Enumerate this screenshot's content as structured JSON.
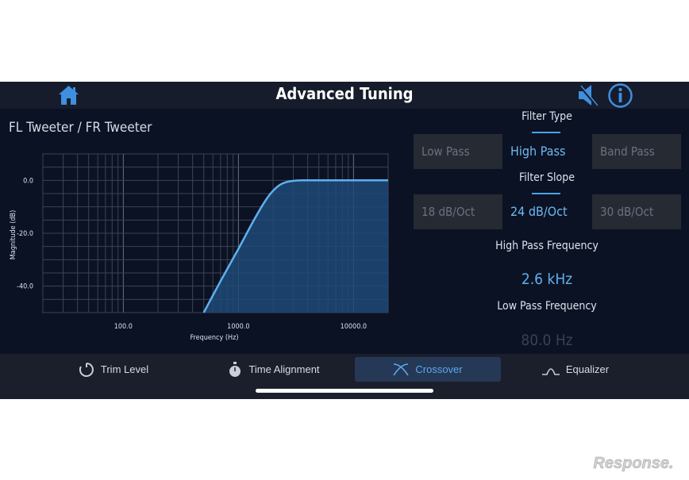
{
  "app": {
    "title": "Advanced Tuning"
  },
  "topbar": {
    "home_icon": "home-icon",
    "speaker_icon": "speaker-mute-icon",
    "info_icon": "info-icon"
  },
  "channel_title": "FL Tweeter / FR Tweeter",
  "chart_data": {
    "type": "area",
    "title": "",
    "xlabel": "Frequency (Hz)",
    "ylabel": "Magnitude (dB)",
    "xscale": "log",
    "xlim": [
      20,
      20000
    ],
    "ylim": [
      -50,
      10
    ],
    "x_tick_labels": [
      "100.0",
      "1000.0",
      "10000.0"
    ],
    "x_ticks": [
      100,
      1000,
      10000
    ],
    "y_tick_labels": [
      "0.0",
      "-20.0",
      "-40.0"
    ],
    "y_ticks": [
      0,
      -20,
      -40
    ],
    "grid": true,
    "series": [
      {
        "x": [
          500,
          700,
          1000,
          1400,
          1800,
          2200,
          2600,
          3200,
          4000,
          6000,
          10000,
          20000
        ],
        "y": [
          -50,
          -38,
          -26,
          -14,
          -6,
          -2,
          -0.5,
          0,
          0,
          0,
          0,
          0
        ]
      }
    ],
    "line_color": "#5fb0ee",
    "fill_color": "#1e4a78"
  },
  "filter_type": {
    "label": "Filter Type",
    "options": [
      "Low Pass",
      "High Pass",
      "Band Pass"
    ],
    "selected": "High Pass"
  },
  "filter_slope": {
    "label": "Filter Slope",
    "options": [
      "18 dB/Oct",
      "24 dB/Oct",
      "30 dB/Oct"
    ],
    "selected": "24 dB/Oct"
  },
  "high_pass": {
    "label": "High Pass Frequency",
    "value": "2.6 kHz",
    "color": "#5fb0ee"
  },
  "low_pass": {
    "label": "Low Pass Frequency",
    "value": "80.0 Hz",
    "color": "#3a4150"
  },
  "tabs": [
    {
      "label": "Trim Level",
      "icon": "dial-icon",
      "active": false
    },
    {
      "label": "Time Alignment",
      "icon": "stopwatch-icon",
      "active": false
    },
    {
      "label": "Crossover",
      "icon": "crossover-icon",
      "active": true
    },
    {
      "label": "Equalizer",
      "icon": "curve-icon",
      "active": false
    }
  ],
  "watermark": "Response."
}
